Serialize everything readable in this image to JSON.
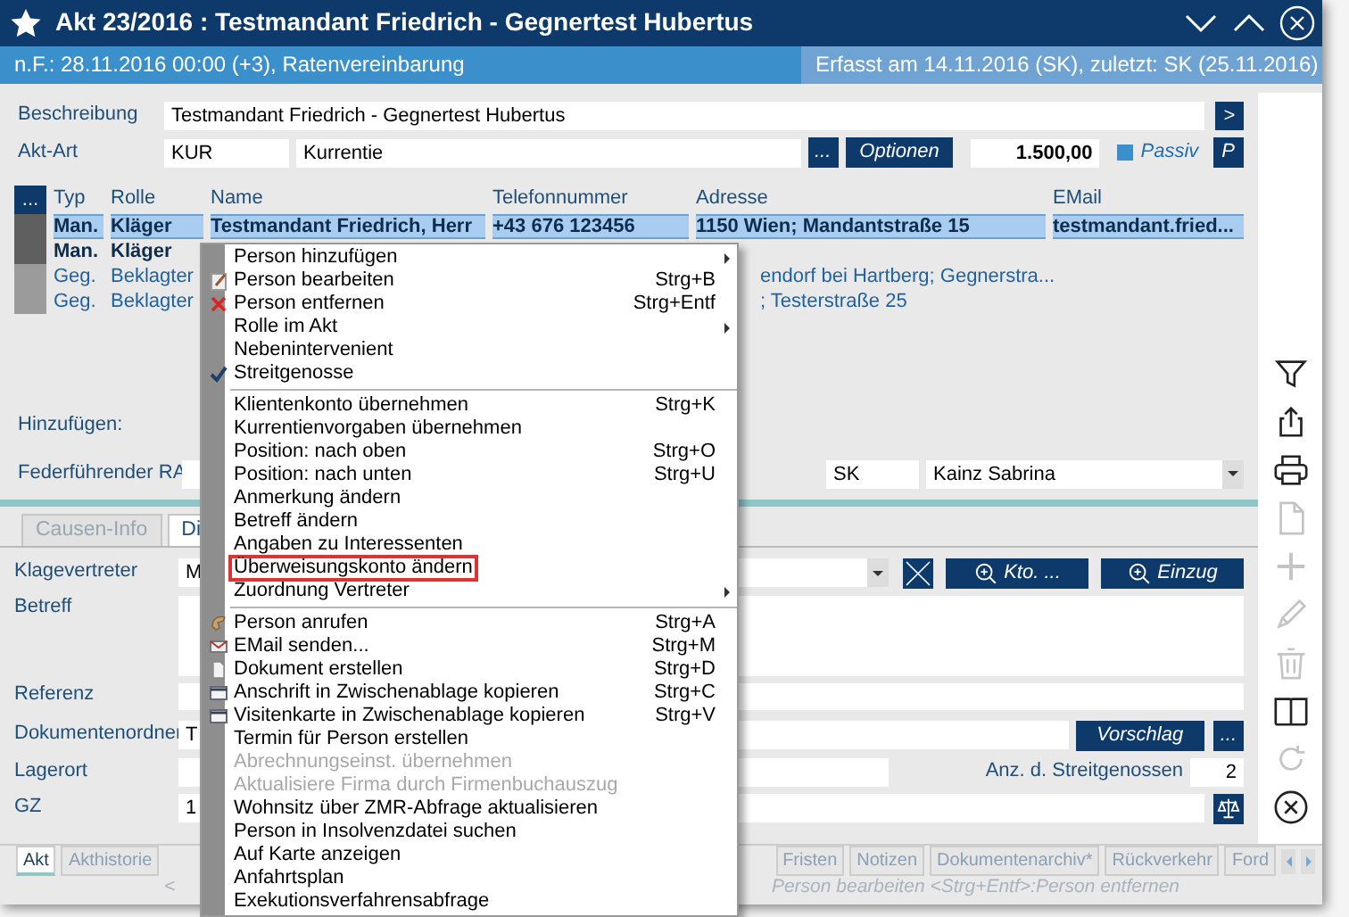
{
  "window": {
    "title": "Akt 23/2016 : Testmandant Friedrich - Gegnertest Hubertus"
  },
  "info_bar": {
    "left": "n.F.: 28.11.2016 00:00 (+3), Ratenvereinbarung",
    "right": "Erfasst am 14.11.2016 (SK), zuletzt: SK (25.11.2016)"
  },
  "description": {
    "label": "Beschreibung",
    "value": "Testmandant Friedrich - Gegnertest Hubertus",
    "button": ">"
  },
  "file_type": {
    "label": "Akt-Art",
    "code": "KUR",
    "name": "Kurrentie",
    "more_button": "...",
    "options_button": "Optionen",
    "amount": "1.500,00",
    "passive": {
      "label": "Passiv",
      "checked": true
    },
    "p_button": "P"
  },
  "persons": {
    "menu_button": "...",
    "columns": [
      "Typ",
      "Rolle",
      "Name",
      "Telefonnummer",
      "Adresse",
      "EMail"
    ],
    "rows": [
      {
        "kind": "client",
        "selected": true,
        "type": "Man.",
        "role": "Kläger",
        "name": "Testmandant Friedrich, Herr",
        "phone": "+43 676 123456",
        "address": "1150 Wien; Mandantstraße 15",
        "email": "testmandant.fried..."
      },
      {
        "kind": "client",
        "selected": false,
        "type": "Man.",
        "role": "Kläger"
      },
      {
        "kind": "opponent",
        "selected": false,
        "type": "Geg.",
        "role": "Beklagter",
        "address": "endorf bei Hartberg; Gegnerstra..."
      },
      {
        "kind": "opponent",
        "selected": false,
        "type": "Geg.",
        "role": "Beklagter",
        "address": "; Testerstraße 25"
      }
    ]
  },
  "add_label": "Hinzufügen:",
  "lead_lawyer": {
    "label": "Federführender RA",
    "code": "SK",
    "name": "Kainz Sabrina"
  },
  "tabs": [
    {
      "label": "Causen-Info",
      "selected": false
    },
    {
      "label": "Di",
      "selected": true
    }
  ],
  "form": {
    "plaintiff_rep": {
      "label": "Klagevertreter",
      "value": "M",
      "account_button": "Kto. ...",
      "collection_button": "Einzug"
    },
    "subject": {
      "label": "Betreff"
    },
    "reference": {
      "label": "Referenz"
    },
    "doc_folder": {
      "label": "Dokumentenordner",
      "value": "T",
      "suggest_button": "Vorschlag",
      "more_button": "..."
    },
    "storage": {
      "label": "Lagerort"
    },
    "co_litigants": {
      "label": "Anz. d. Streitgenossen",
      "value": "2"
    },
    "gz": {
      "label": "GZ",
      "value": "1"
    }
  },
  "bottom_tabs": [
    {
      "label": "Akt",
      "selected": true
    },
    {
      "label": "Akthistorie",
      "selected": false
    },
    {
      "label": "Fristen",
      "selected": false
    },
    {
      "label": "Notizen",
      "selected": false
    },
    {
      "label": "Dokumentenarchiv*",
      "selected": false
    },
    {
      "label": "Rückverkehr",
      "selected": false
    },
    {
      "label": "Ford",
      "selected": false
    }
  ],
  "status_bar": {
    "left": "<",
    "right": "Person bearbeiten <Strg+Entf>:Person entfernen"
  },
  "toolbar": [
    {
      "kind": "filter",
      "disabled": false
    },
    {
      "kind": "share",
      "disabled": false
    },
    {
      "kind": "print",
      "disabled": false
    },
    {
      "kind": "document",
      "disabled": true
    },
    {
      "kind": "plus",
      "disabled": true
    },
    {
      "kind": "pencil",
      "disabled": true
    },
    {
      "kind": "trash",
      "disabled": true
    },
    {
      "kind": "book",
      "disabled": false
    },
    {
      "kind": "refresh",
      "disabled": true
    },
    {
      "kind": "close",
      "disabled": false
    }
  ],
  "context_menu": [
    {
      "kind": "plain",
      "label": "Person hinzufügen",
      "submenu": true,
      "disabled": false,
      "outlined": false
    },
    {
      "kind": "edit",
      "label": "Person bearbeiten",
      "shortcut": "Strg+B",
      "submenu": false,
      "disabled": false,
      "outlined": false
    },
    {
      "kind": "remove",
      "label": "Person entfernen",
      "shortcut": "Strg+Entf",
      "submenu": false,
      "disabled": false,
      "outlined": false
    },
    {
      "kind": "plain",
      "label": "Rolle im Akt",
      "submenu": true,
      "disabled": false,
      "outlined": false
    },
    {
      "kind": "plain",
      "label": "Nebenintervenient",
      "submenu": false,
      "disabled": false,
      "outlined": false
    },
    {
      "kind": "check",
      "label": "Streitgenosse",
      "submenu": false,
      "disabled": false,
      "outlined": false
    },
    {
      "kind": "separator"
    },
    {
      "kind": "plain",
      "label": "Klientenkonto übernehmen",
      "shortcut": "Strg+K",
      "submenu": false,
      "disabled": false,
      "outlined": false
    },
    {
      "kind": "plain",
      "label": "Kurrentienvorgaben übernehmen",
      "submenu": false,
      "disabled": false,
      "outlined": false
    },
    {
      "kind": "plain",
      "label": "Position: nach oben",
      "shortcut": "Strg+O",
      "submenu": false,
      "disabled": false,
      "outlined": false
    },
    {
      "kind": "plain",
      "label": "Position: nach unten",
      "shortcut": "Strg+U",
      "submenu": false,
      "disabled": false,
      "outlined": false
    },
    {
      "kind": "plain",
      "label": "Anmerkung ändern",
      "submenu": false,
      "disabled": false,
      "outlined": false
    },
    {
      "kind": "plain",
      "label": "Betreff ändern",
      "submenu": false,
      "disabled": false,
      "outlined": false
    },
    {
      "kind": "plain",
      "label": "Angaben zu Interessenten",
      "submenu": false,
      "disabled": false,
      "outlined": false
    },
    {
      "kind": "plain",
      "label": "Überweisungskonto ändern",
      "submenu": false,
      "disabled": false,
      "outlined": true
    },
    {
      "kind": "plain",
      "label": "Zuordnung Vertreter",
      "submenu": true,
      "disabled": false,
      "outlined": false
    },
    {
      "kind": "separator"
    },
    {
      "kind": "phone",
      "label": "Person anrufen",
      "shortcut": "Strg+A",
      "submenu": false,
      "disabled": false,
      "outlined": false
    },
    {
      "kind": "mail",
      "label": "EMail senden...",
      "shortcut": "Strg+M",
      "submenu": false,
      "disabled": false,
      "outlined": false
    },
    {
      "kind": "document",
      "label": "Dokument erstellen",
      "shortcut": "Strg+D",
      "submenu": false,
      "disabled": false,
      "outlined": false
    },
    {
      "kind": "card",
      "label": "Anschrift in Zwischenablage kopieren",
      "shortcut": "Strg+C",
      "submenu": false,
      "disabled": false,
      "outlined": false
    },
    {
      "kind": "card",
      "label": "Visitenkarte in Zwischenablage kopieren",
      "shortcut": "Strg+V",
      "submenu": false,
      "disabled": false,
      "outlined": false
    },
    {
      "kind": "plain",
      "label": "Termin für Person erstellen",
      "submenu": false,
      "disabled": false,
      "outlined": false
    },
    {
      "kind": "plain",
      "label": "Abrechnungseinst. übernehmen",
      "submenu": false,
      "disabled": true,
      "outlined": false
    },
    {
      "kind": "plain",
      "label": "Aktualisiere Firma durch Firmenbuchauszug",
      "submenu": false,
      "disabled": true,
      "outlined": false
    },
    {
      "kind": "plain",
      "label": "Wohnsitz über ZMR-Abfrage aktualisieren",
      "submenu": false,
      "disabled": false,
      "outlined": false
    },
    {
      "kind": "plain",
      "label": "Person in Insolvenzdatei suchen",
      "submenu": false,
      "disabled": false,
      "outlined": false
    },
    {
      "kind": "plain",
      "label": "Auf Karte anzeigen",
      "submenu": false,
      "disabled": false,
      "outlined": false
    },
    {
      "kind": "plain",
      "label": "Anfahrtsplan",
      "submenu": false,
      "disabled": false,
      "outlined": false
    },
    {
      "kind": "plain",
      "label": "Exekutionsverfahrensabfrage",
      "submenu": false,
      "disabled": false,
      "outlined": false
    }
  ]
}
